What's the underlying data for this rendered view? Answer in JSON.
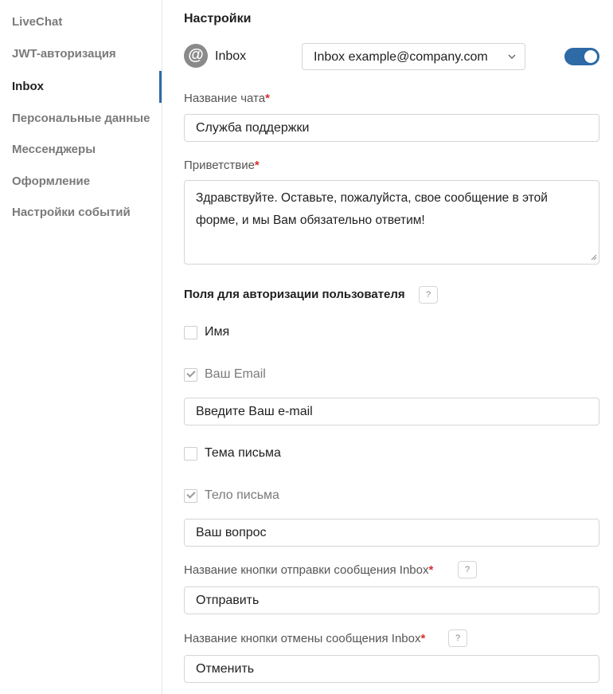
{
  "sidebar": {
    "items": [
      {
        "label": "LiveChat"
      },
      {
        "label": "JWT-авторизация"
      },
      {
        "label": "Inbox"
      },
      {
        "label": "Персональные данные"
      },
      {
        "label": "Мессенджеры"
      },
      {
        "label": "Оформление"
      },
      {
        "label": "Настройки событий"
      }
    ],
    "active_item": "Inbox"
  },
  "settings": {
    "title": "Настройки",
    "at_icon": "@",
    "inbox_label": "Inbox",
    "inbox_select_value": "Inbox example@company.com",
    "inbox_enabled": true
  },
  "chat_name": {
    "label": "Название чата",
    "required_mark": "*",
    "value": "Служба поддержки"
  },
  "greeting": {
    "label": "Приветствие",
    "required_mark": "*",
    "value": "Здравствуйте. Оставьте, пожалуйста, свое сообщение в этой форме, и мы Вам обязательно ответим!"
  },
  "auth_fields": {
    "title": "Поля для авторизации пользователя",
    "help": "?",
    "items": [
      {
        "label": "Имя",
        "checked": false,
        "disabled": false
      },
      {
        "label": "Ваш Email",
        "checked": true,
        "disabled": true,
        "input_value": "Введите Ваш e-mail"
      },
      {
        "label": "Тема письма",
        "checked": false,
        "disabled": false
      },
      {
        "label": "Тело письма",
        "checked": true,
        "disabled": true,
        "input_value": "Ваш вопрос"
      }
    ]
  },
  "send_button_name": {
    "label": "Название кнопки отправки сообщения Inbox",
    "required_mark": "*",
    "help": "?",
    "value": "Отправить"
  },
  "cancel_button_name": {
    "label": "Название кнопки отмены сообщения Inbox",
    "required_mark": "*",
    "help": "?",
    "value": "Отменить"
  },
  "colors": {
    "accent": "#2d6aa6",
    "required": "#d62f2f"
  }
}
